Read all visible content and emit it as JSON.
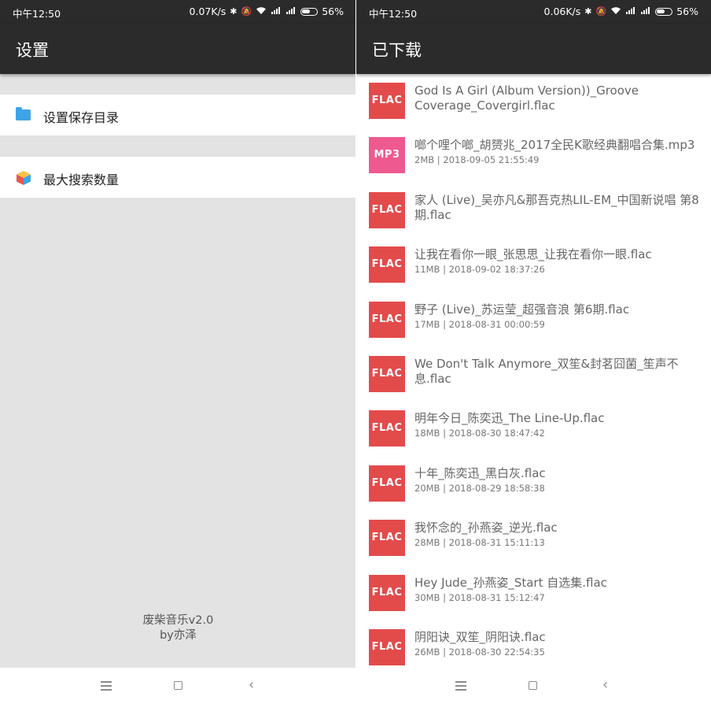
{
  "left": {
    "status": {
      "time": "中午12:50",
      "speed": "0.07K/s",
      "battery": "56%"
    },
    "title": "设置",
    "items": [
      {
        "label": "设置保存目录"
      },
      {
        "label": "最大搜索数量"
      }
    ],
    "footer": {
      "line1": "废柴音乐v2.0",
      "line2": "by亦泽"
    }
  },
  "right": {
    "status": {
      "time": "中午12:50",
      "speed": "0.06K/s",
      "battery": "56%"
    },
    "title": "已下载",
    "downloads": [
      {
        "format": "FLAC",
        "name": "God Is A Girl (Album Version))_Groove Coverage_Covergirl.flac",
        "meta": ""
      },
      {
        "format": "MP3",
        "name": "啷个哩个啷_胡赟兆_2017全民K歌经典翻唱合集.mp3",
        "meta": "2MB | 2018-09-05 21:55:49"
      },
      {
        "format": "FLAC",
        "name": "家人 (Live)_吴亦凡&那吾克热LIL-EM_中国新说唱 第8期.flac",
        "meta": ""
      },
      {
        "format": "FLAC",
        "name": "让我在看你一眼_张思思_让我在看你一眼.flac",
        "meta": "11MB | 2018-09-02 18:37:26"
      },
      {
        "format": "FLAC",
        "name": "野子 (Live)_苏运莹_超强音浪 第6期.flac",
        "meta": "17MB | 2018-08-31 00:00:59"
      },
      {
        "format": "FLAC",
        "name": "We Don't Talk Anymore_双笙&封茗囧菌_笙声不息.flac",
        "meta": ""
      },
      {
        "format": "FLAC",
        "name": "明年今日_陈奕迅_The Line-Up.flac",
        "meta": "18MB | 2018-08-30 18:47:42"
      },
      {
        "format": "FLAC",
        "name": "十年_陈奕迅_黑白灰.flac",
        "meta": "20MB | 2018-08-29 18:58:38"
      },
      {
        "format": "FLAC",
        "name": "我怀念的_孙燕姿_逆光.flac",
        "meta": "28MB | 2018-08-31 15:11:13"
      },
      {
        "format": "FLAC",
        "name": "Hey Jude_孙燕姿_Start 自选集.flac",
        "meta": "30MB | 2018-08-31 15:12:47"
      },
      {
        "format": "FLAC",
        "name": "阴阳诀_双笙_阴阳诀.flac",
        "meta": "26MB | 2018-08-30 22:54:35"
      }
    ]
  }
}
